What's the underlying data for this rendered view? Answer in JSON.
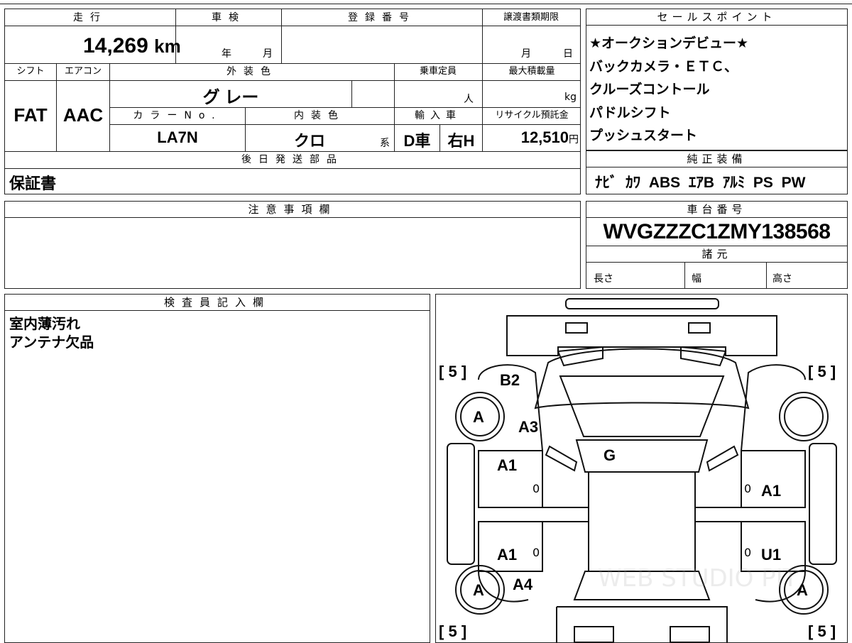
{
  "top": {
    "mileage_label": "走行",
    "mileage_value": "14,269",
    "mileage_unit": "km",
    "inspection_label": "車検",
    "inspection_year": "年",
    "inspection_month": "月",
    "registration_label": "登録番号",
    "transfer_label": "譲渡書類期限",
    "transfer_month": "月",
    "transfer_day": "日",
    "shift_label": "シフト",
    "shift_value": "FAT",
    "ac_label": "エアコン",
    "ac_value": "AAC",
    "exterior_label": "外装色",
    "exterior_value": "グ レー",
    "capacity_label": "乗車定員",
    "capacity_unit": "人",
    "maxload_label": "最大積載量",
    "maxload_unit": "kg",
    "colorno_label": "カラーNo.",
    "colorno_value": "LA7N",
    "interior_label": "内装色",
    "interior_value": "クロ",
    "interior_suffix": "系",
    "import_label": "輸入車",
    "import_value1": "D車",
    "import_value2": "右H",
    "recycle_label": "リサイクル預託金",
    "recycle_value": "12,510",
    "recycle_unit": "円",
    "parts_label": "後日発送部品",
    "parts_value": "保証書"
  },
  "sales": {
    "header": "セールスポイント",
    "lines": [
      "★オークションデビュー★",
      "バックカメラ・ＥＴＣ、",
      "クルーズコントール",
      "パドルシフト",
      "プッシュスタート"
    ]
  },
  "equipment": {
    "header": "純正装備",
    "items": [
      "ﾅﾋﾞ",
      "ｶﾜ",
      "ABS",
      "ｴｱB",
      "ｱﾙﾐ",
      "PS",
      "PW"
    ]
  },
  "notes": {
    "header": "注意事項欄"
  },
  "chassis": {
    "header": "車台番号",
    "value": "WVGZZZC1ZMY138568",
    "specs_header": "諸元",
    "length": "長さ",
    "width": "幅",
    "height": "高さ"
  },
  "inspector": {
    "header": "検査員記入欄",
    "lines": [
      "室内薄汚れ",
      "アンテナ欠品"
    ]
  },
  "diagram": {
    "tire_fl": "5",
    "tire_fr": "5",
    "tire_rl": "5",
    "tire_rr": "5",
    "wheel_marks": [
      "A",
      "A",
      "A"
    ],
    "marks": {
      "b2": "B2",
      "a3": "A3",
      "g": "G",
      "a1_fl": "A1",
      "a1_fr": "A1",
      "a1_rl": "A1",
      "u1_rr": "U1",
      "a4": "A4"
    },
    "small_zeros": [
      "0",
      "0",
      "0",
      "0"
    ],
    "watermark": "WEB STUDIO PIT"
  }
}
